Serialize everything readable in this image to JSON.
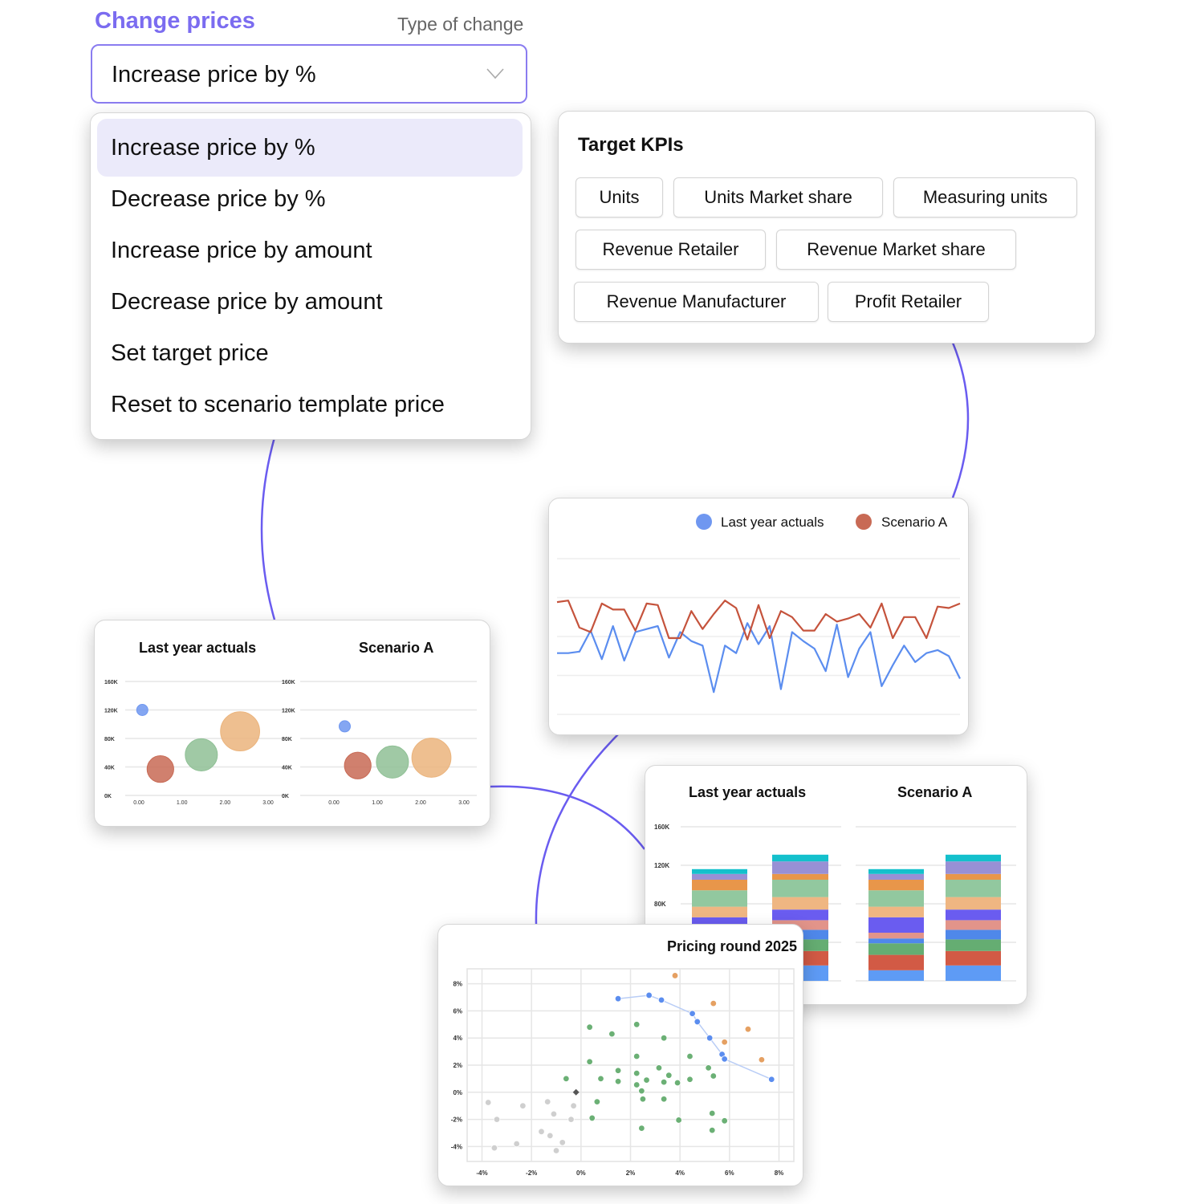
{
  "header": {
    "title": "Change prices",
    "subtitle": "Type of change",
    "selected_value": "Increase price by %",
    "chevron_icon": "chevron-down-icon"
  },
  "dropdown": {
    "options": [
      {
        "label": "Increase price by %",
        "selected": true
      },
      {
        "label": "Decrease price by %",
        "selected": false
      },
      {
        "label": "Increase price by amount",
        "selected": false
      },
      {
        "label": "Decrease price by amount",
        "selected": false
      },
      {
        "label": "Set target price",
        "selected": false
      },
      {
        "label": "Reset to scenario template price",
        "selected": false
      }
    ]
  },
  "kpis": {
    "title": "Target KPIs",
    "chips": [
      "Units",
      "Units Market share",
      "Measuring units",
      "Revenue Retailer",
      "Revenue Market share",
      "Revenue Manufacturer",
      "Profit Retailer"
    ]
  },
  "colors": {
    "accent": "#6c5ce7",
    "connector": "#6a5cf0",
    "blue": "#5b8def",
    "red": "#c5533c",
    "selected_bg": "#ebeafa"
  },
  "chart_data": [
    {
      "id": "line",
      "type": "line",
      "title": "",
      "legend": [
        "Last year actuals",
        "Scenario A"
      ],
      "legend_position": "top-right",
      "grid": true,
      "ylim": [
        0,
        100
      ],
      "series": [
        {
          "name": "Last year actuals",
          "color": "#5b8def",
          "values": [
            52,
            52,
            53,
            67,
            48,
            70,
            47,
            66,
            68,
            70,
            49,
            66,
            60,
            57,
            26,
            57,
            52,
            72,
            58,
            70,
            28,
            66,
            60,
            55,
            40,
            71,
            36,
            55,
            66,
            30,
            44,
            57,
            46,
            52,
            54,
            50,
            35
          ]
        },
        {
          "name": "Scenario A",
          "color": "#c5533c",
          "values": [
            86,
            87,
            69,
            66,
            85,
            81,
            81,
            67,
            85,
            84,
            62,
            62,
            80,
            68,
            78,
            87,
            82,
            61,
            84,
            62,
            80,
            76,
            67,
            67,
            78,
            73,
            75,
            78,
            69,
            85,
            62,
            76,
            76,
            62,
            83,
            82,
            85
          ]
        }
      ]
    },
    {
      "id": "bubble",
      "type": "scatter",
      "subtype": "bubble",
      "ylabel_ticks": [
        "0K",
        "40K",
        "80K",
        "120K",
        "160K"
      ],
      "xlabel_ticks": [
        "0.00",
        "1.00",
        "2.00",
        "3.00"
      ],
      "xlim": [
        0,
        3
      ],
      "ylim": [
        0,
        160000
      ],
      "panels": [
        {
          "title": "Last year actuals",
          "points": [
            {
              "x": 0.08,
              "y": 120000,
              "size": 1,
              "color": "#6f97f0"
            },
            {
              "x": 0.5,
              "y": 37000,
              "size": 2,
              "color": "#c86a55"
            },
            {
              "x": 1.45,
              "y": 57000,
              "size": 3.5,
              "color": "#8fc095"
            },
            {
              "x": 2.35,
              "y": 90000,
              "size": 6,
              "color": "#ebb47d"
            }
          ]
        },
        {
          "title": "Scenario A",
          "points": [
            {
              "x": 0.25,
              "y": 97000,
              "size": 1,
              "color": "#6f97f0"
            },
            {
              "x": 0.55,
              "y": 42000,
              "size": 2,
              "color": "#c86a55"
            },
            {
              "x": 1.35,
              "y": 47000,
              "size": 3.5,
              "color": "#8fc095"
            },
            {
              "x": 2.25,
              "y": 53000,
              "size": 6,
              "color": "#ebb47d"
            }
          ]
        }
      ]
    },
    {
      "id": "stacked",
      "type": "bar",
      "stacked": true,
      "ylabel_ticks": [
        "80K",
        "120K",
        "160K"
      ],
      "ylim": [
        0,
        160000
      ],
      "segment_colors": [
        "#5e9bf5",
        "#d25a45",
        "#65ad72",
        "#4f88ea",
        "#e2948a",
        "#6a5cf0",
        "#efb682",
        "#92c89f",
        "#e8964a",
        "#9890d5",
        "#14c0cc"
      ],
      "panels": [
        {
          "title": "Last year actuals",
          "bars": [
            [
              11,
              16,
              12,
              5,
              6,
              16,
              11,
              17,
              11,
              6,
              5
            ],
            [
              16,
              15,
              12,
              10,
              10,
              11,
              13,
              18,
              6,
              13,
              7
            ]
          ]
        },
        {
          "title": "Scenario A",
          "bars": [
            [
              11,
              16,
              12,
              5,
              6,
              16,
              11,
              17,
              11,
              6,
              5
            ],
            [
              16,
              15,
              12,
              10,
              10,
              11,
              13,
              18,
              6,
              13,
              7
            ]
          ]
        }
      ],
      "unit": "K"
    },
    {
      "id": "scatter",
      "type": "scatter",
      "title": "Pricing round 2025",
      "xlim": [
        -4.6,
        8.6
      ],
      "ylim": [
        -5.1,
        9.1
      ],
      "xticks": [
        "-4%",
        "-2%",
        "0%",
        "2%",
        "4%",
        "6%",
        "8%"
      ],
      "yticks": [
        "8%",
        "6%",
        "4%",
        "2%",
        "0%",
        "-2%",
        "-4%"
      ],
      "grid": true,
      "series": [
        {
          "name": "grey",
          "color": "#cfcfcf",
          "points": [
            [
              -3.75,
              -0.75
            ],
            [
              -3.4,
              -2
            ],
            [
              -3.5,
              -4.1
            ],
            [
              -2.35,
              -1
            ],
            [
              -2.6,
              -3.8
            ],
            [
              -1.35,
              -0.7
            ],
            [
              -1.1,
              -1.6
            ],
            [
              -1.6,
              -2.9
            ],
            [
              -1.25,
              -3.2
            ],
            [
              -0.75,
              -3.7
            ],
            [
              -1.0,
              -4.3
            ],
            [
              -0.3,
              -1
            ],
            [
              -0.4,
              -2
            ]
          ]
        },
        {
          "name": "green",
          "color": "#6bb075",
          "points": [
            [
              -0.6,
              1.0
            ],
            [
              0.35,
              4.8
            ],
            [
              0.35,
              2.25
            ],
            [
              0.45,
              -1.9
            ],
            [
              0.65,
              -0.7
            ],
            [
              0.8,
              1.0
            ],
            [
              1.25,
              4.3
            ],
            [
              1.5,
              1.6
            ],
            [
              1.5,
              0.8
            ],
            [
              2.25,
              5.0
            ],
            [
              2.25,
              2.65
            ],
            [
              2.25,
              1.4
            ],
            [
              2.25,
              0.55
            ],
            [
              2.45,
              0.1
            ],
            [
              2.5,
              -0.5
            ],
            [
              2.45,
              -2.65
            ],
            [
              2.65,
              0.9
            ],
            [
              3.15,
              1.8
            ],
            [
              3.35,
              4.0
            ],
            [
              3.35,
              0.75
            ],
            [
              3.35,
              -0.5
            ],
            [
              3.55,
              1.25
            ],
            [
              3.9,
              0.7
            ],
            [
              3.95,
              -2.05
            ],
            [
              4.4,
              2.65
            ],
            [
              4.4,
              0.95
            ],
            [
              5.15,
              1.8
            ],
            [
              5.35,
              1.2
            ],
            [
              5.3,
              -1.55
            ],
            [
              5.3,
              -2.8
            ],
            [
              5.8,
              -2.1
            ]
          ]
        },
        {
          "name": "orange",
          "color": "#e5a062",
          "points": [
            [
              3.8,
              8.6
            ],
            [
              5.35,
              6.55
            ],
            [
              6.75,
              4.65
            ],
            [
              5.8,
              3.7
            ],
            [
              7.3,
              2.4
            ]
          ]
        },
        {
          "name": "blue",
          "color": "#5b8def",
          "connected": true,
          "points": [
            [
              1.5,
              6.9
            ],
            [
              2.75,
              7.15
            ],
            [
              3.25,
              6.8
            ],
            [
              4.5,
              5.8
            ],
            [
              4.7,
              5.2
            ],
            [
              5.2,
              4.0
            ],
            [
              5.7,
              2.8
            ],
            [
              5.8,
              2.45
            ],
            [
              7.7,
              0.95
            ]
          ]
        },
        {
          "name": "marker",
          "color": "#555555",
          "shape": "diamond",
          "points": [
            [
              -0.2,
              0.0
            ]
          ]
        }
      ]
    }
  ]
}
